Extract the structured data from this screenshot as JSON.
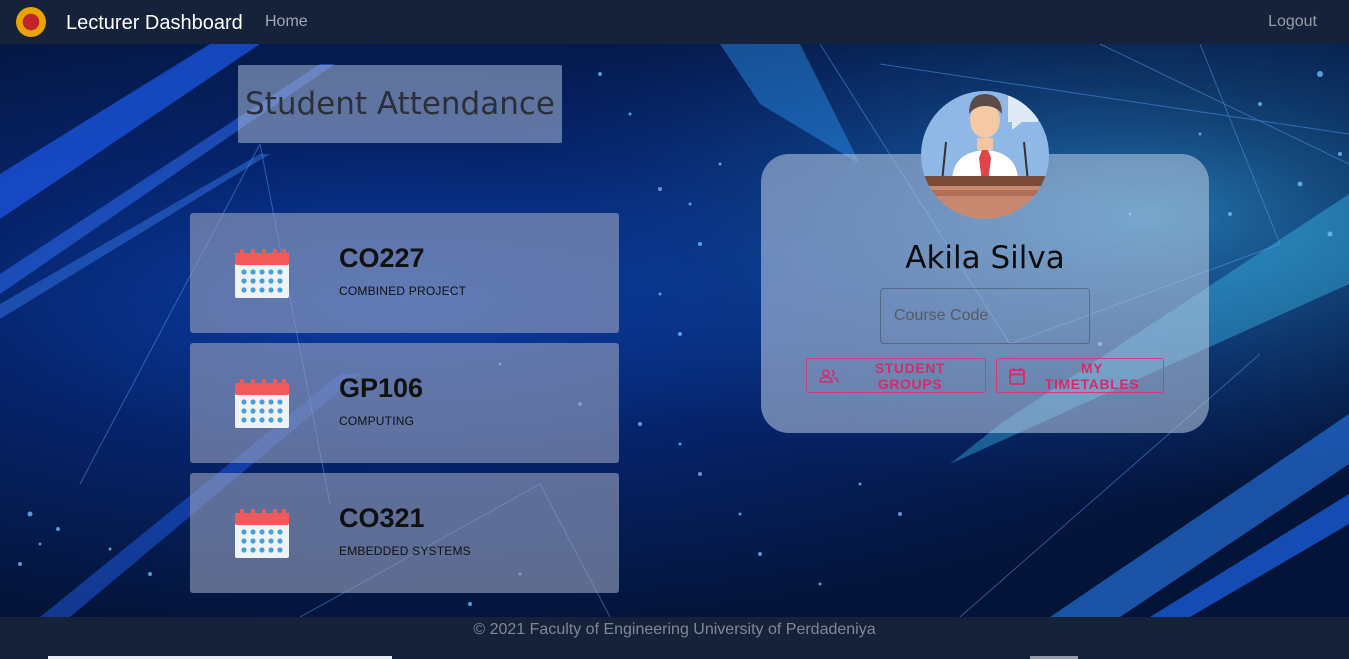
{
  "navbar": {
    "brand": "Lecturer Dashboard",
    "home": "Home",
    "logout": "Logout",
    "logo_icon": "university-crest-icon"
  },
  "title": "Student Attendance",
  "courses": [
    {
      "code": "CO227",
      "name": "COMBINED PROJECT",
      "icon": "calendar-icon"
    },
    {
      "code": "GP106",
      "name": "COMPUTING",
      "icon": "calendar-icon"
    },
    {
      "code": "CO321",
      "name": "EMBEDDED SYSTEMS",
      "icon": "calendar-icon"
    }
  ],
  "profile": {
    "name": "Akila Silva",
    "avatar_icon": "lecturer-podium-avatar",
    "course_input": {
      "placeholder": "Course Code",
      "value": ""
    },
    "buttons": {
      "student_groups": "STUDENT GROUPS",
      "my_timetables": "MY TIMETABLES"
    }
  },
  "footer": {
    "text": "© 2021 Faculty of Engineering University of Perdadeniya"
  },
  "colors": {
    "navbar_bg": "#16213a",
    "accent_pink": "#d12d6a",
    "calendar_red": "#f05a5a",
    "calendar_dot": "#4a9fd8"
  }
}
